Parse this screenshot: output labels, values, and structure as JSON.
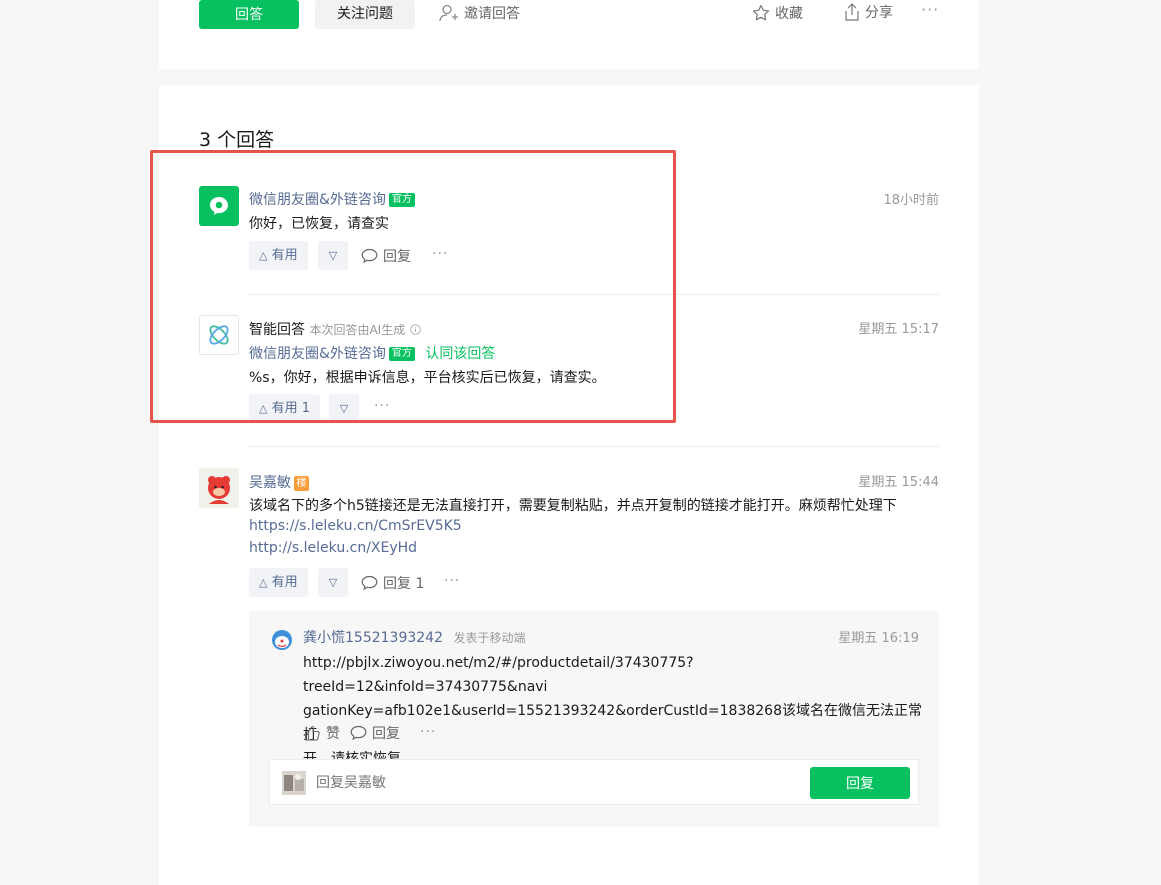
{
  "toolbar": {
    "answer_label": "回答",
    "follow_label": "关注问题",
    "invite_label": "邀请回答",
    "favorite_label": "收藏",
    "share_label": "分享",
    "more_label": "···"
  },
  "answers": {
    "count_label": "3 个回答",
    "items": [
      {
        "author": "微信朋友圈&外链咨询",
        "badge": "官方",
        "time": "18小时前",
        "content": "你好，已恢复，请查实",
        "useful_label": "有用",
        "down_label": "▽",
        "reply_label": "回复",
        "more_label": "···"
      },
      {
        "author": "智能回答",
        "ai_note": "本次回答由AI生成",
        "time": "星期五 15:17",
        "endorser": "微信朋友圈&外链咨询",
        "endorser_badge": "官方",
        "endorse_label": "认同该回答",
        "content": "%s，你好，根据申诉信息，平台核实后已恢复，请查实。",
        "useful_label": "有用 1",
        "down_label": "▽",
        "more_label": "···"
      },
      {
        "author": "吴嘉敏",
        "owner_badge": "楼",
        "time": "星期五 15:44",
        "content": "该域名下的多个h5链接还是无法直接打开，需要复制粘贴，并点开复制的链接才能打开。麻烦帮忙处理下",
        "links": [
          "https://s.leleku.cn/CmSrEV5K5",
          "http://s.leleku.cn/XEyHd"
        ],
        "useful_label": "有用",
        "down_label": "▽",
        "reply_label": "回复 1",
        "more_label": "···"
      }
    ]
  },
  "comment": {
    "author": "龚小慌15521393242",
    "source": "发表于移动端",
    "time": "星期五 16:19",
    "content_lines": [
      "http://pbjlx.ziwoyou.net/m2/#/productdetail/37430775?treeId=12&infoId=37430775&navi",
      "gationKey=afb102e1&userId=15521393242&orderCustId=1838268该域名在微信无法正常打",
      "开，请核实恢复。"
    ],
    "like_label": "赞",
    "reply_label": "回复",
    "more_label": "···"
  },
  "reply_input": {
    "placeholder": "回复吴嘉敏",
    "submit_label": "回复"
  },
  "colors": {
    "accent": "#07c160",
    "link": "#576b95",
    "highlight": "#e5534b",
    "owner_badge": "#fa9d3b"
  }
}
